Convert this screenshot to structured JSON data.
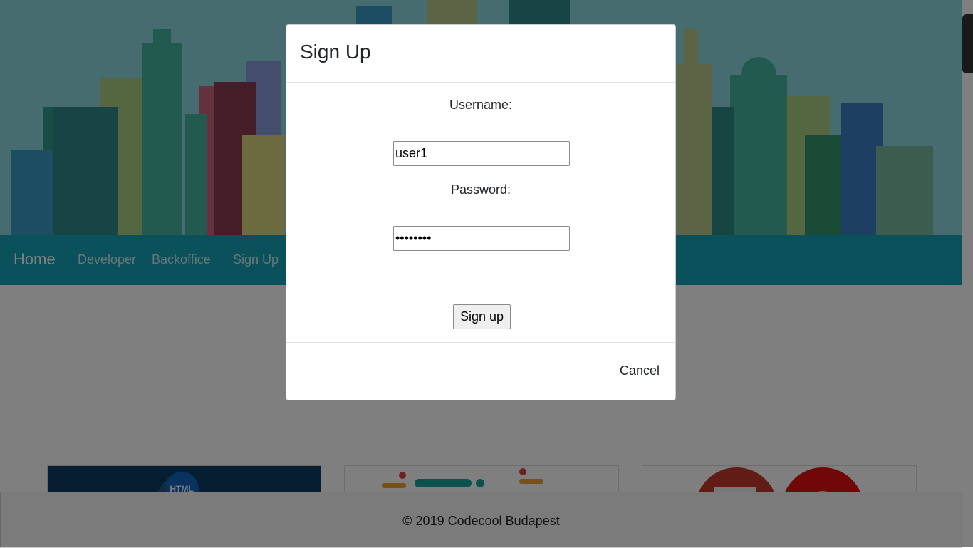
{
  "navbar": {
    "brand": "Home",
    "links": [
      "Developer",
      "Backoffice",
      "Sign Up"
    ]
  },
  "footer": {
    "text": "© 2019 Codecool Budapest"
  },
  "cards": {
    "html_badge": "HTML"
  },
  "modal": {
    "title": "Sign Up",
    "username_label": "Username:",
    "username_value": "user1",
    "password_label": "Password:",
    "password_value": "password",
    "submit_label": "Sign up",
    "cancel_label": "Cancel"
  },
  "colors": {
    "navbar": "#17a2b8",
    "hero_sky": "#8fd8e0",
    "backdrop": "rgba(0,0,0,0.5)"
  }
}
